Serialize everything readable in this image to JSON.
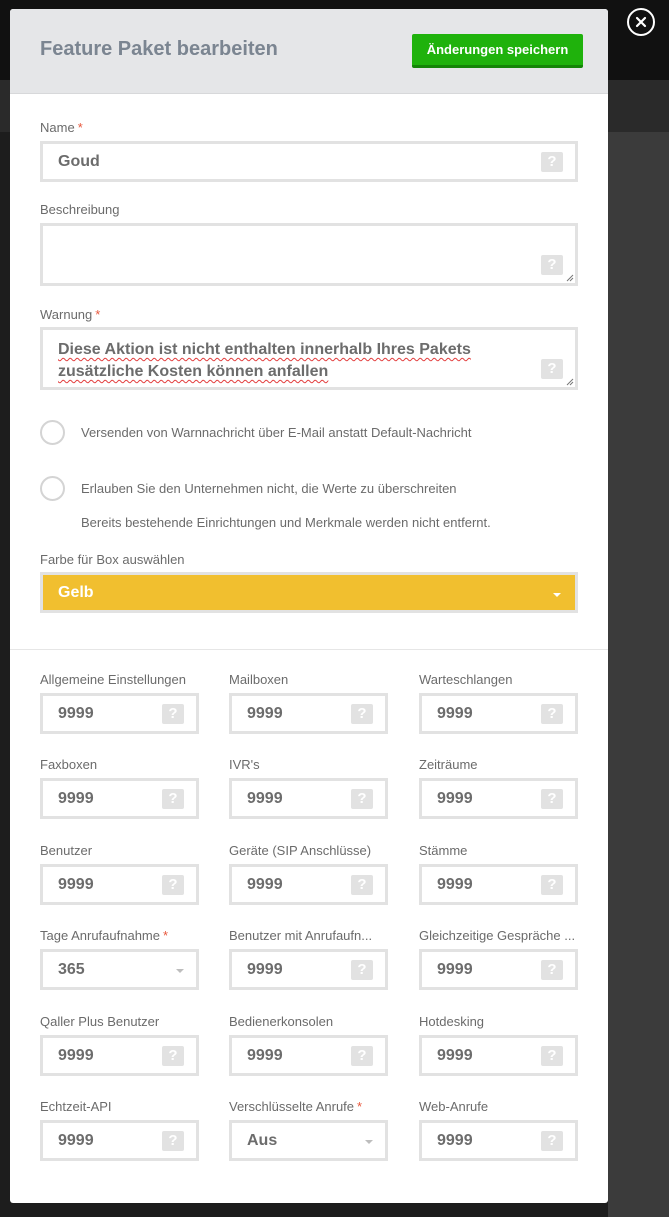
{
  "modal": {
    "title": "Feature Paket bearbeiten",
    "save_label": "Änderungen speichern"
  },
  "name": {
    "label": "Name",
    "required": "*",
    "value": "Goud"
  },
  "description": {
    "label": "Beschreibung",
    "value": ""
  },
  "warning": {
    "label": "Warnung",
    "required": "*",
    "value": "Diese Aktion ist nicht enthalten innerhalb Ihres Pakets zusätzliche Kosten können anfallen"
  },
  "options": {
    "email_warning_label": "Versenden von Warnnachricht über E-Mail anstatt Default-Nachricht",
    "no_exceed_label": "Erlauben Sie den Unternehmen nicht, die Werte zu überschreiten",
    "no_exceed_hint": "Bereits bestehende Einrichtungen und Merkmale werden nicht entfernt."
  },
  "color": {
    "label": "Farbe für Box auswählen",
    "value": "Gelb",
    "swatch": "#f1bf2f"
  },
  "help_glyph": "?",
  "limits": [
    {
      "label": "Allgemeine Einstellungen",
      "value": "9999",
      "kind": "input"
    },
    {
      "label": "Mailboxen",
      "value": "9999",
      "kind": "input"
    },
    {
      "label": "Warteschlangen",
      "value": "9999",
      "kind": "input"
    },
    {
      "label": "Faxboxen",
      "value": "9999",
      "kind": "input"
    },
    {
      "label": "IVR's",
      "value": "9999",
      "kind": "input"
    },
    {
      "label": "Zeiträume",
      "value": "9999",
      "kind": "input"
    },
    {
      "label": "Benutzer",
      "value": "9999",
      "kind": "input"
    },
    {
      "label": "Geräte (SIP Anschlüsse)",
      "value": "9999",
      "kind": "input"
    },
    {
      "label": "Stämme",
      "value": "9999",
      "kind": "input"
    },
    {
      "label": "Tage Anrufaufnahme",
      "required": "*",
      "value": "365",
      "kind": "select"
    },
    {
      "label": "Benutzer mit Anrufaufn...",
      "value": "9999",
      "kind": "input"
    },
    {
      "label": "Gleichzeitige Gespräche ...",
      "value": "9999",
      "kind": "input"
    },
    {
      "label": "Qaller Plus Benutzer",
      "value": "9999",
      "kind": "input"
    },
    {
      "label": "Bedienerkonsolen",
      "value": "9999",
      "kind": "input"
    },
    {
      "label": "Hotdesking",
      "value": "9999",
      "kind": "input"
    },
    {
      "label": "Echtzeit-API",
      "value": "9999",
      "kind": "input"
    },
    {
      "label": "Verschlüsselte Anrufe",
      "required": "*",
      "value": "Aus",
      "kind": "select"
    },
    {
      "label": "Web-Anrufe",
      "value": "9999",
      "kind": "input"
    }
  ]
}
